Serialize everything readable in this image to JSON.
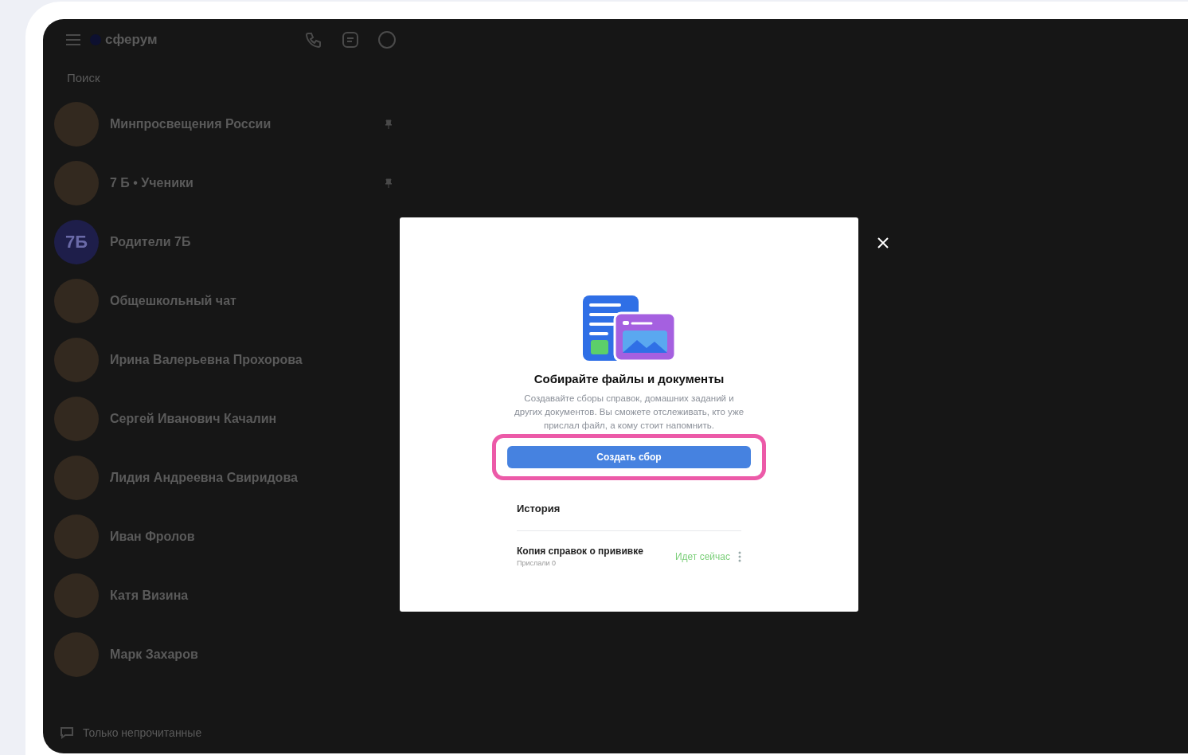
{
  "app": {
    "logo": "сферум",
    "search": {
      "placeholder": "Поиск"
    },
    "chats": [
      {
        "name": "Минпросвещения России",
        "pinned": true
      },
      {
        "name": "7 Б • Ученики",
        "pinned": true
      },
      {
        "name": "Родители 7Б",
        "avatar_text": "7Б",
        "pinned": false
      },
      {
        "name": "Общешкольный чат",
        "pinned": false
      },
      {
        "name": "Ирина Валерьевна Прохорова",
        "pinned": false
      },
      {
        "name": "Сергей Иванович Качалин",
        "pinned": false
      },
      {
        "name": "Лидия Андреевна Свиридова",
        "pinned": false
      },
      {
        "name": "Иван Фролов",
        "pinned": false
      },
      {
        "name": "Катя Визина",
        "pinned": false
      },
      {
        "name": "Марк Захаров",
        "pinned": false
      }
    ],
    "filter": "Только непрочитанные"
  },
  "dialog": {
    "title": "Собирайте файлы и документы",
    "description": "Создавайте сборы справок, домашних заданий и других документов. Вы сможете отслеживать, кто уже прислал файл, а кому стоит напомнить.",
    "button": {
      "label": "Создать сбор",
      "highlighted": true
    },
    "history_title": "История",
    "history": [
      {
        "title": "Копия справок о прививке",
        "subtitle": "Прислали 0",
        "status": "Идет сейчас"
      }
    ]
  }
}
